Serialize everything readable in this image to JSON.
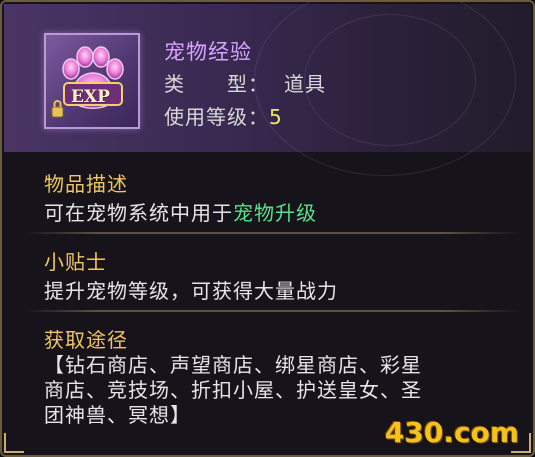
{
  "item": {
    "icon": "exp-paw-icon",
    "icon_badge_text": "EXP",
    "name": "宠物经验",
    "type_label": "类　　型：",
    "type_value": "道具",
    "level_label": "使用等级：",
    "level_value": "5"
  },
  "description": {
    "title": "物品描述",
    "text_prefix": "可在宠物系统中用于",
    "text_highlight": "宠物升级"
  },
  "tip": {
    "title": "小贴士",
    "text": "提升宠物等级，可获得大量战力"
  },
  "source": {
    "title": "获取途径",
    "lines": [
      "【钻石商店、声望商店、绑星商店、彩星",
      "商店、竞技场、折扣小屋、护送皇女、圣",
      "团神兽、冥想】"
    ]
  },
  "watermark": "430.com",
  "colors": {
    "name": "#d7a3ff",
    "section_title": "#f0c565",
    "highlight": "#58e08a",
    "level_value": "#f2e36a",
    "frame": "#6b5c3e"
  }
}
